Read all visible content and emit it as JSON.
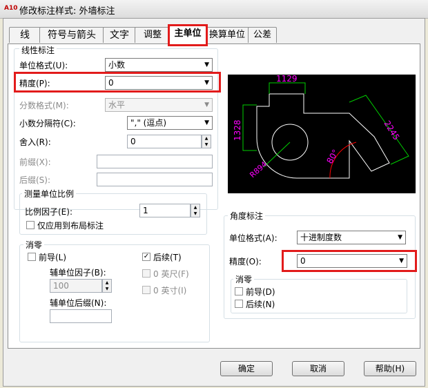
{
  "window": {
    "app_icon": "A10",
    "title": "修改标注样式: 外墙标注"
  },
  "tabs": [
    "线",
    "符号与箭头",
    "文字",
    "调整",
    "主单位",
    "换算单位",
    "公差"
  ],
  "active_tab": "主单位",
  "linear": {
    "group_title": "线性标注",
    "unit_format_label": "单位格式(U):",
    "unit_format_value": "小数",
    "precision_label": "精度(P):",
    "precision_value": "0",
    "fraction_label": "分数格式(M):",
    "fraction_value": "水平",
    "decimal_sep_label": "小数分隔符(C):",
    "decimal_sep_value": "\",\" (逗点)",
    "roundoff_label": "舍入(R):",
    "roundoff_value": "0",
    "prefix_label": "前缀(X):",
    "prefix_value": "",
    "suffix_label": "后缀(S):",
    "suffix_value": ""
  },
  "measurement": {
    "group_title": "测量单位比例",
    "scale_label": "比例因子(E):",
    "scale_value": "1",
    "layout_only_label": "仅应用到布局标注",
    "layout_only_checked": false
  },
  "zero_suppress": {
    "group_title": "消零",
    "leading_label": "前导(L)",
    "leading_checked": false,
    "sub_factor_label": "辅单位因子(B):",
    "sub_factor_value": "100",
    "sub_suffix_label": "辅单位后缀(N):",
    "sub_suffix_value": "",
    "trailing_label": "后续(T)",
    "trailing_checked": true,
    "feet_label": "0 英尺(F)",
    "feet_checked": false,
    "inches_label": "0 英寸(I)",
    "inches_checked": false
  },
  "preview": {
    "dim_top": "1129",
    "dim_left": "1328",
    "dim_right": "2245",
    "dim_angle": "80°",
    "dim_radius": "R894",
    "colors": {
      "line": "#00d000",
      "text": "#ff00ff",
      "arc": "#ff0000",
      "shape": "#ffffff"
    }
  },
  "angular": {
    "group_title": "角度标注",
    "unit_format_label": "单位格式(A):",
    "unit_format_value": "十进制度数",
    "precision_label": "精度(O):",
    "precision_value": "0",
    "zero_title": "消零",
    "leading_label": "前导(D)",
    "leading_checked": false,
    "trailing_label": "后续(N)",
    "trailing_checked": false
  },
  "buttons": {
    "ok": "确定",
    "cancel": "取消",
    "help": "帮助(H)"
  },
  "highlight_color": "#e21b1b"
}
